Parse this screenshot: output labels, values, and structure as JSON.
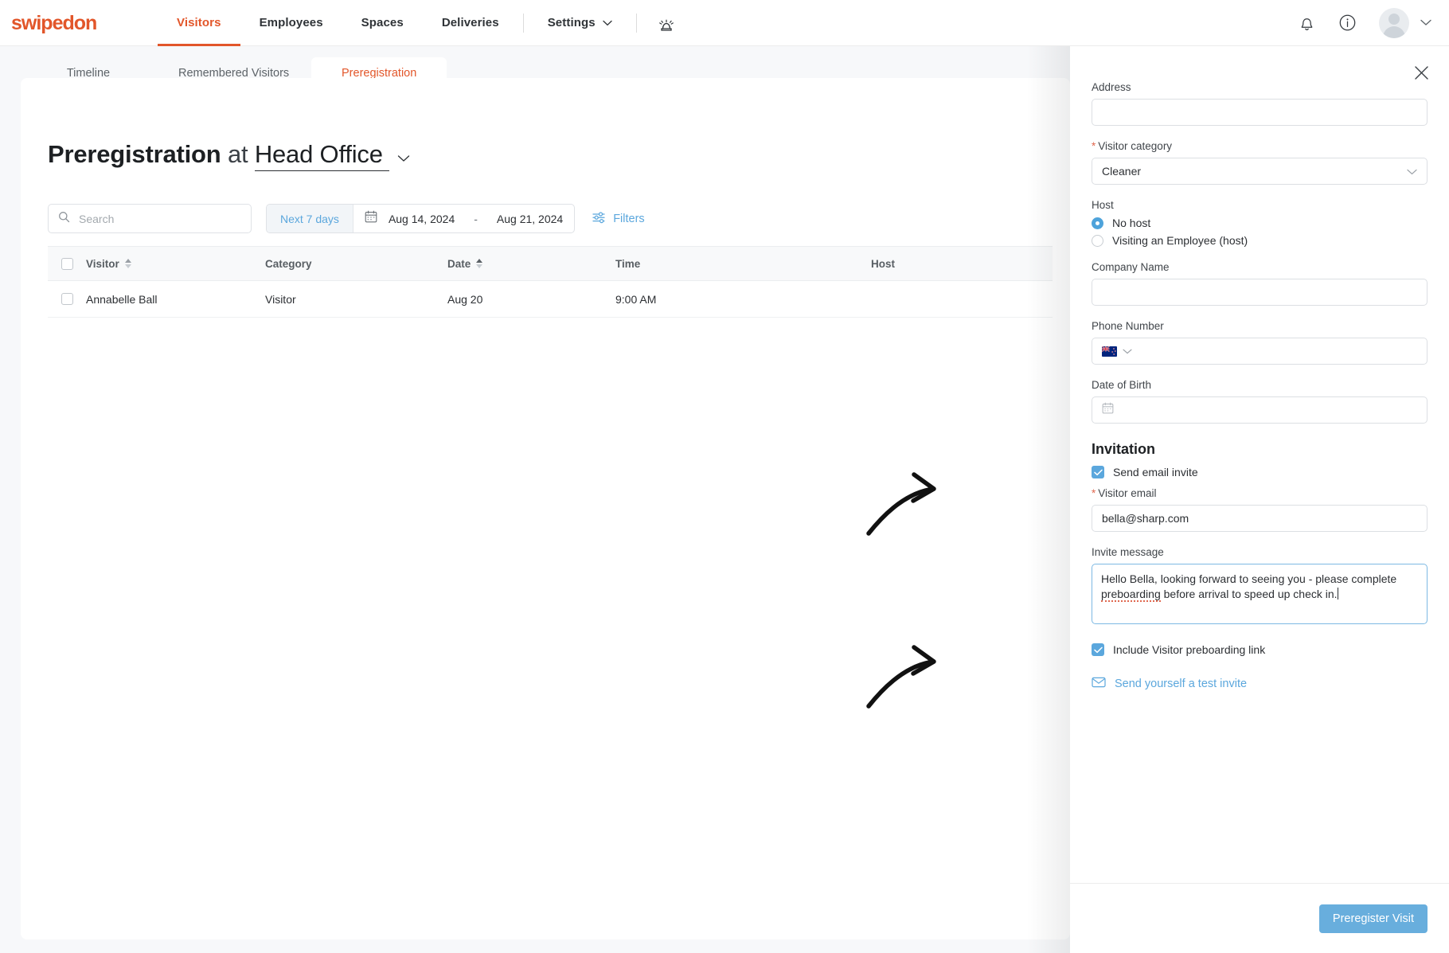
{
  "nav": {
    "brand": "swipedon",
    "items": [
      {
        "label": "Visitors",
        "active": true
      },
      {
        "label": "Employees",
        "active": false
      },
      {
        "label": "Spaces",
        "active": false
      },
      {
        "label": "Deliveries",
        "active": false
      },
      {
        "label": "Settings",
        "active": false,
        "caret": true
      }
    ],
    "emergency_icon": "siren-icon",
    "right_icons": [
      "bell-icon",
      "info-icon",
      "avatar",
      "chevron-down-icon"
    ]
  },
  "tabs": [
    {
      "label": "Timeline",
      "active": false
    },
    {
      "label": "Remembered Visitors",
      "active": false
    },
    {
      "label": "Preregistration",
      "active": true
    }
  ],
  "page": {
    "title_bold": "Preregistration",
    "title_at": "at",
    "location": "Head Office",
    "location_caret": "⌄"
  },
  "search": {
    "placeholder": "Search",
    "value": ""
  },
  "date_range": {
    "preset": "Next 7 days",
    "from": "Aug 14, 2024",
    "dash": "-",
    "to": "Aug 21, 2024"
  },
  "filters": {
    "label": "Filters"
  },
  "table": {
    "columns": [
      "Visitor",
      "Category",
      "Date",
      "Time",
      "Host"
    ],
    "rows": [
      {
        "visitor": "Annabelle Ball",
        "category": "Visitor",
        "date": "Aug 20",
        "time": "9:00 AM",
        "host": ""
      }
    ]
  },
  "drawer": {
    "close_icon": "close-icon",
    "address": {
      "label": "Address",
      "value": ""
    },
    "visitor_category": {
      "label": "Visitor category",
      "required": true,
      "value": "Cleaner"
    },
    "host": {
      "label": "Host",
      "options": [
        {
          "label": "No host",
          "selected": true
        },
        {
          "label": "Visiting an Employee (host)",
          "selected": false
        }
      ]
    },
    "company_name": {
      "label": "Company Name",
      "value": ""
    },
    "phone_number": {
      "label": "Phone Number",
      "value": "",
      "country_flag": "new-zealand-flag"
    },
    "date_of_birth": {
      "label": "Date of Birth",
      "value": ""
    },
    "invitation": {
      "heading": "Invitation",
      "send_email_invite": {
        "label": "Send email invite",
        "checked": true
      },
      "visitor_email": {
        "label": "Visitor email",
        "required": true,
        "value": "bella@sharp.com"
      },
      "invite_message": {
        "label": "Invite message",
        "value_line1": "Hello Bella, looking forward to seeing you - please complete",
        "value_part_misspelled": "preboarding",
        "value_line2_rest": " before arrival to speed up check in."
      },
      "include_preboarding_link": {
        "label": "Include Visitor preboarding link",
        "checked": true
      },
      "test_invite": {
        "label": "Send yourself a test invite",
        "icon": "envelope-icon"
      }
    },
    "submit": {
      "label": "Preregister Visit"
    }
  },
  "colors": {
    "brand_orange": "#e2562a",
    "accent_blue": "#5ba7dd",
    "primary_button": "#68aedd",
    "required_red": "#e0684f"
  }
}
